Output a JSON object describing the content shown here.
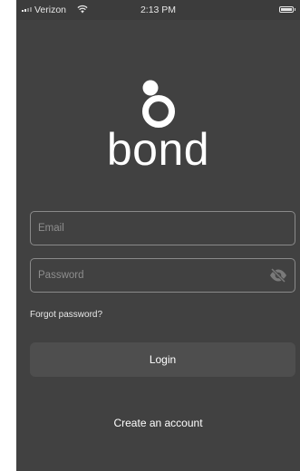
{
  "status_bar": {
    "carrier": "Verizon",
    "time": "2:13 PM",
    "signal_icon": "cellular-signal-icon",
    "wifi_icon": "wifi-icon",
    "battery_icon": "battery-icon"
  },
  "logo": {
    "wordmark": "bond",
    "mark_icon": "bond-logo-icon"
  },
  "form": {
    "email_placeholder": "Email",
    "email_value": "",
    "password_placeholder": "Password",
    "password_value": "",
    "password_toggle_icon": "eye-off-icon",
    "forgot_password": "Forgot password?",
    "login_label": "Login",
    "create_account": "Create an account"
  },
  "colors": {
    "background": "#414141",
    "field_border": "#8a8a8a",
    "button_background": "#4e4e4e",
    "text": "#ffffff"
  }
}
